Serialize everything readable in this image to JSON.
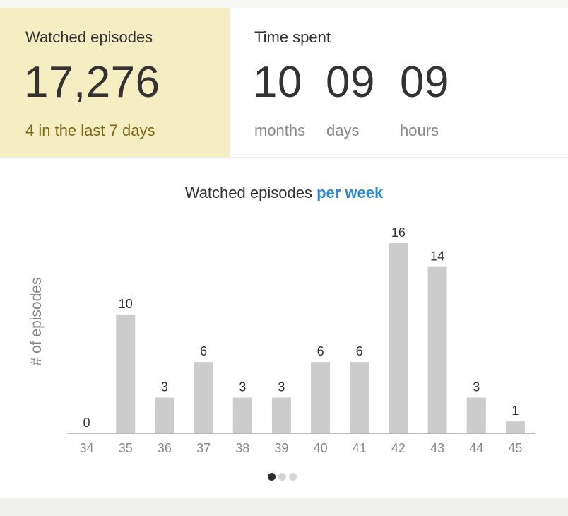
{
  "stats": {
    "watched": {
      "label": "Watched episodes",
      "value": "17,276",
      "recent": "4 in the last 7 days"
    },
    "time_spent": {
      "label": "Time spent",
      "units": [
        {
          "value": "10",
          "unit": "months"
        },
        {
          "value": "09",
          "unit": "days"
        },
        {
          "value": "09",
          "unit": "hours"
        }
      ]
    }
  },
  "chart": {
    "title_prefix": "Watched episodes",
    "title_highlight": "per week"
  },
  "chart_data": {
    "type": "bar",
    "title": "Watched episodes per week",
    "xlabel": "",
    "ylabel": "# of episodes",
    "categories": [
      "34",
      "35",
      "36",
      "37",
      "38",
      "39",
      "40",
      "41",
      "42",
      "43",
      "44",
      "45"
    ],
    "values": [
      0,
      10,
      3,
      6,
      3,
      3,
      6,
      6,
      16,
      14,
      3,
      1
    ],
    "ylim": [
      0,
      16
    ],
    "grid": false,
    "data_labels": true
  },
  "pager": {
    "count": 3,
    "active": 0
  },
  "colors": {
    "highlight_card": "#f6eec3",
    "recent_text": "#7b6717",
    "accent": "#2f88d1",
    "bar": "#cccccc",
    "unit_text": "#888888"
  }
}
